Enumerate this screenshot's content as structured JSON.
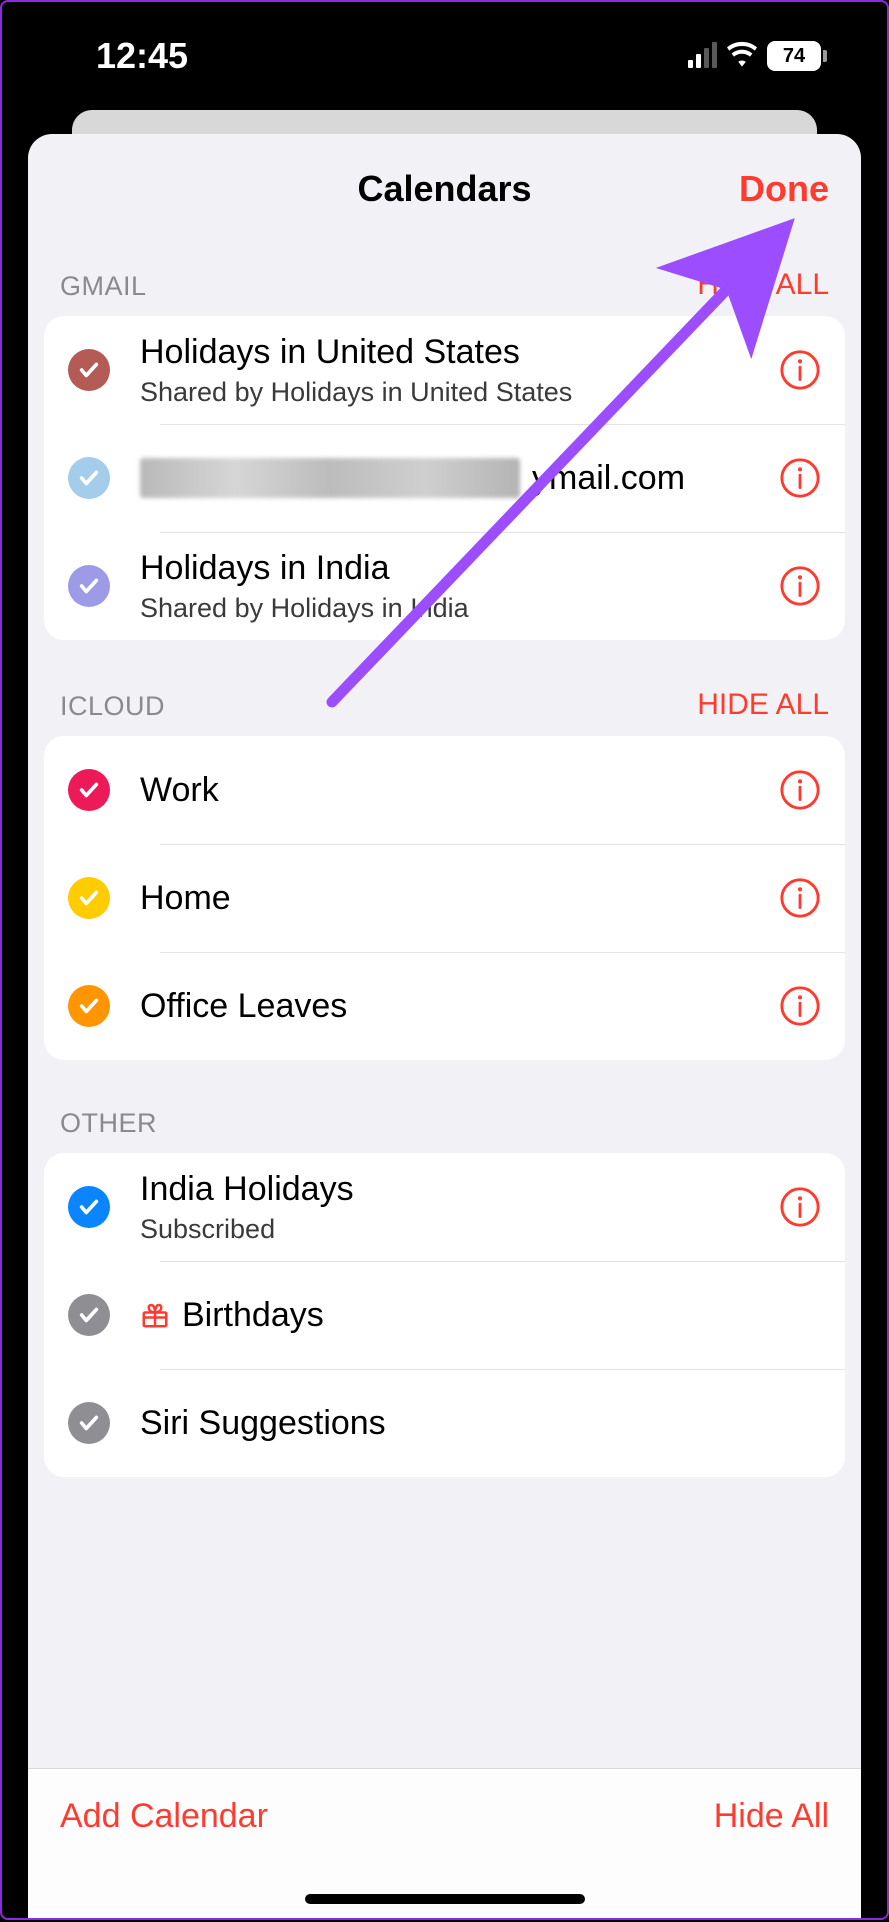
{
  "status": {
    "time": "12:45",
    "battery": "74"
  },
  "header": {
    "title": "Calendars",
    "done": "Done"
  },
  "sections": {
    "gmail": {
      "label": "GMAIL",
      "action": "HIDE ALL",
      "items": [
        {
          "title": "Holidays in United States",
          "subtitle": "Shared by Holidays in United States",
          "color": "#b35b54",
          "has_info": true
        },
        {
          "title_suffix": "ymail.com",
          "redacted": true,
          "color": "#a4cdeb",
          "has_info": true
        },
        {
          "title": "Holidays in India",
          "subtitle": "Shared by Holidays in India",
          "color": "#9d9ae8",
          "has_info": true
        }
      ]
    },
    "icloud": {
      "label": "ICLOUD",
      "action": "HIDE ALL",
      "items": [
        {
          "title": "Work",
          "color": "#ec1a58",
          "has_info": true
        },
        {
          "title": "Home",
          "color": "#ffcc00",
          "has_info": true
        },
        {
          "title": "Office Leaves",
          "color": "#ff9500",
          "has_info": true
        }
      ]
    },
    "other": {
      "label": "OTHER",
      "items": [
        {
          "title": "India Holidays",
          "subtitle": "Subscribed",
          "color": "#0a84ff",
          "has_info": true
        },
        {
          "title": "Birthdays",
          "color": "#8e8e93",
          "has_info": false,
          "gift": true
        },
        {
          "title": "Siri Suggestions",
          "color": "#8e8e93",
          "has_info": false
        }
      ]
    }
  },
  "toolbar": {
    "add": "Add Calendar",
    "hide_all": "Hide All"
  }
}
